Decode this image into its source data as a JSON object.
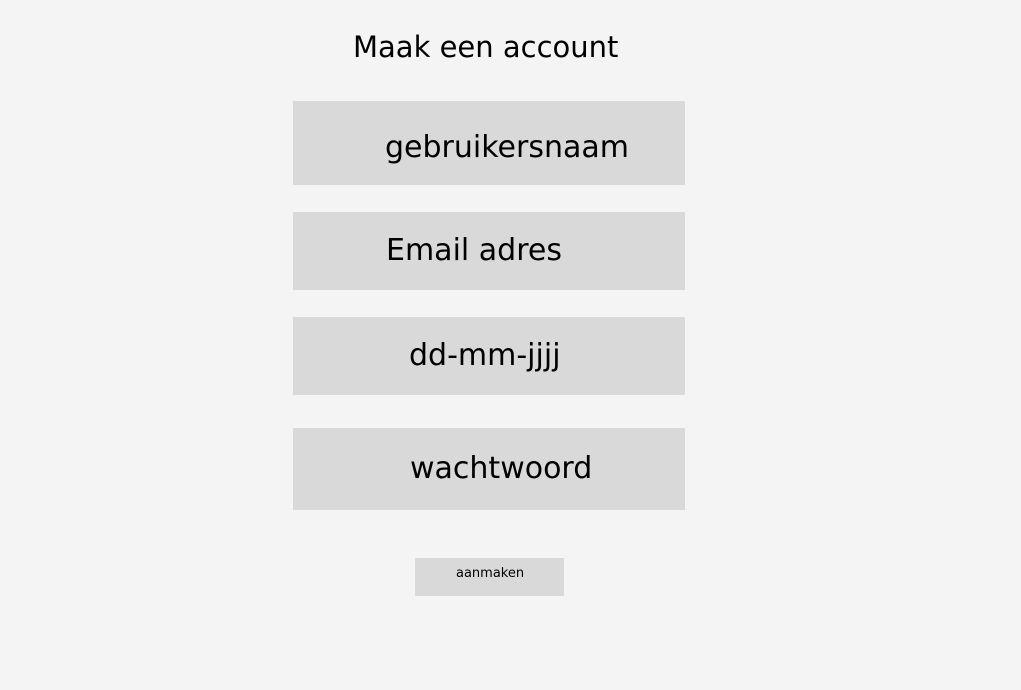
{
  "page": {
    "title": "Maak een account"
  },
  "form": {
    "username_placeholder": "gebruikersnaam",
    "email_placeholder": "Email adres",
    "birthdate_placeholder": "dd-mm-jjjj",
    "password_placeholder": "wachtwoord",
    "submit_label": "aanmaken"
  },
  "colors": {
    "background": "#f4f4f4",
    "field_background": "#d9d9d9",
    "text": "#000000"
  }
}
